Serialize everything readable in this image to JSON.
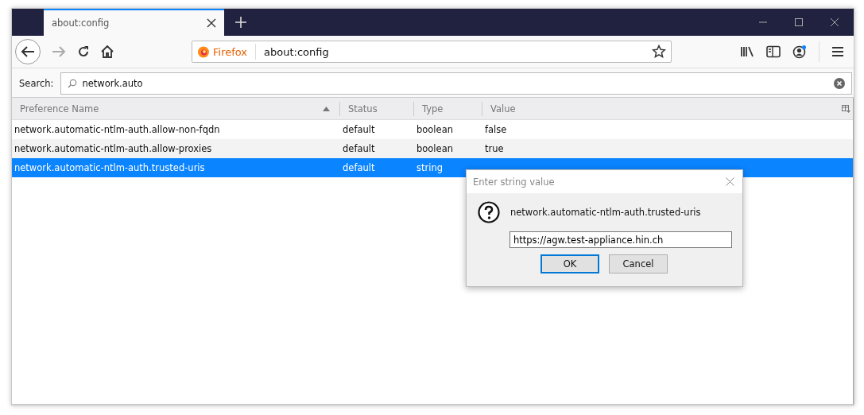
{
  "tabs": [
    {
      "title": "about:config",
      "selected": true
    }
  ],
  "address_bar": {
    "identity": "Firefox",
    "url": "about:config"
  },
  "search": {
    "label": "Search:",
    "value": "network.auto"
  },
  "table": {
    "columns": [
      {
        "label": "Preference Name",
        "sorted": true
      },
      {
        "label": "Status",
        "sorted": false
      },
      {
        "label": "Type",
        "sorted": false
      },
      {
        "label": "Value",
        "sorted": false
      }
    ],
    "rows": [
      {
        "name": "network.automatic-ntlm-auth.allow-non-fqdn",
        "status": "default",
        "type": "boolean",
        "value": "false",
        "selected": false
      },
      {
        "name": "network.automatic-ntlm-auth.allow-proxies",
        "status": "default",
        "type": "boolean",
        "value": "true",
        "selected": false
      },
      {
        "name": "network.automatic-ntlm-auth.trusted-uris",
        "status": "default",
        "type": "string",
        "selected": true
      }
    ]
  },
  "dialog": {
    "title": "Enter string value",
    "message": "network.automatic-ntlm-auth.trusted-uris",
    "value": "https://agw.test-appliance.hin.ch",
    "buttons": [
      {
        "label": "OK",
        "default": true
      },
      {
        "label": "Cancel",
        "default": false
      }
    ]
  }
}
